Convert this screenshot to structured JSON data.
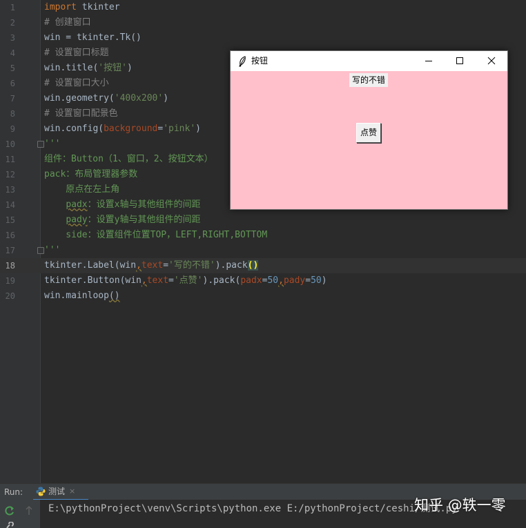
{
  "editor": {
    "line_numbers": [
      "1",
      "2",
      "3",
      "4",
      "5",
      "6",
      "7",
      "8",
      "9",
      "10",
      "11",
      "12",
      "13",
      "14",
      "15",
      "16",
      "17",
      "18",
      "19",
      "20"
    ],
    "line1": {
      "kw": "import",
      "rest": " tkinter"
    },
    "line2": {
      "comment": "# 创建窗口"
    },
    "line3": {
      "text": "win = tkinter.Tk()"
    },
    "line4": {
      "comment": "# 设置窗口标题"
    },
    "line5": {
      "a": "win.title(",
      "str": "'按钮'",
      "b": ")"
    },
    "line6": {
      "comment": "# 设置窗口大小"
    },
    "line7": {
      "a": "win.geometry(",
      "str": "'400x200'",
      "b": ")"
    },
    "line8": {
      "comment": "# 设置窗口配景色"
    },
    "line9": {
      "a": "win.config(",
      "param": "background",
      "eq": "=",
      "str": "'pink'",
      "b": ")"
    },
    "line10": {
      "doc": "'''"
    },
    "line11": {
      "doc": "组件：Button（1、窗口，2、按钮文本）"
    },
    "line12": {
      "doc": "pack：布局管理器参数"
    },
    "line13": {
      "doc": "    原点在左上角"
    },
    "line14": {
      "doc_a": "    ",
      "doc_sq": "padx",
      "doc_b": "：设置x轴与其他组件的间距"
    },
    "line15": {
      "doc_a": "    ",
      "doc_sq": "pady",
      "doc_b": "：设置y轴与其他组件的间距"
    },
    "line16": {
      "doc": "    side：设置组件位置TOP，LEFT,RIGHT,BOTTOM"
    },
    "line17": {
      "doc": "'''"
    },
    "line18": {
      "a": "tkinter.Label(win",
      "comma": ",",
      "param": "text",
      "eq": "=",
      "str": "'写的不错'",
      "b": ").pack",
      "paren": "()"
    },
    "line19": {
      "a": "tkinter.Button(win",
      "comma1": ",",
      "param1": "text",
      "eq1": "=",
      "str": "'点赞'",
      "b": ").pack(",
      "param2": "padx",
      "eq2": "=",
      "num1": "50",
      "comma2": ",",
      "param3": "pady",
      "eq3": "=",
      "num2": "50",
      "c": ")"
    },
    "line20": {
      "a": "win.mainloop",
      "paren": "()"
    }
  },
  "tk_window": {
    "title": "按钮",
    "label_text": "写的不错",
    "button_text": "点赞",
    "background": "#ffc0cb"
  },
  "run_panel": {
    "label": "Run:",
    "tab_label": "测试",
    "tab_close": "×",
    "console_line": "E:\\pythonProject\\venv\\Scripts\\python.exe E:/pythonProject/ceshi/测试.py"
  },
  "watermark": "知乎 @轶一零",
  "icons": {
    "feather": "tk-feather-icon",
    "python": "python-icon",
    "rerun": "rerun-icon",
    "up": "arrow-up-icon",
    "wrench": "wrench-icon"
  }
}
